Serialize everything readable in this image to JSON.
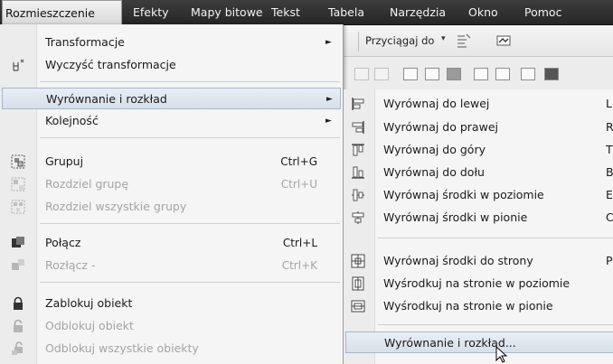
{
  "menubar": {
    "items": [
      {
        "label": "Rozmieszczenie",
        "active": true
      },
      {
        "label": "Efekty"
      },
      {
        "label": "Mapy bitowe"
      },
      {
        "label": "Tekst"
      },
      {
        "label": "Tabela"
      },
      {
        "label": "Narzędzia"
      },
      {
        "label": "Okno"
      },
      {
        "label": "Pomoc"
      }
    ]
  },
  "toolbar": {
    "snap_label": "Przyciągaj do",
    "snap_arrow": "▾"
  },
  "menu": {
    "items": [
      {
        "label": "Transformacje",
        "shortcut": "",
        "submenu": true,
        "disabled": false
      },
      {
        "label": "Wyczyść transformacje",
        "shortcut": "",
        "submenu": false,
        "disabled": false
      },
      {
        "label": "Wyrównanie i rozkład",
        "shortcut": "",
        "submenu": true,
        "disabled": false,
        "highlighted": true
      },
      {
        "label": "Kolejność",
        "shortcut": "",
        "submenu": true,
        "disabled": false
      },
      {
        "label": "Grupuj",
        "shortcut": "Ctrl+G",
        "disabled": false
      },
      {
        "label": "Rozdziel grupę",
        "shortcut": "Ctrl+U",
        "disabled": true
      },
      {
        "label": "Rozdziel wszystkie grupy",
        "shortcut": "",
        "disabled": true
      },
      {
        "label": "Połącz",
        "shortcut": "Ctrl+L",
        "disabled": false
      },
      {
        "label": "Rozłącz -",
        "shortcut": "Ctrl+K",
        "disabled": true
      },
      {
        "label": "Zablokuj obiekt",
        "shortcut": "",
        "disabled": false
      },
      {
        "label": "Odblokuj obiekt",
        "shortcut": "",
        "disabled": true
      },
      {
        "label": "Odblokuj wszystkie obiekty",
        "shortcut": "",
        "disabled": true
      }
    ],
    "submenu_arrow": "►"
  },
  "submenu": {
    "items": [
      {
        "label": "Wyrównaj do lewej",
        "key": "L"
      },
      {
        "label": "Wyrównaj do prawej",
        "key": "R"
      },
      {
        "label": "Wyrównaj do góry",
        "key": "T"
      },
      {
        "label": "Wyrównaj do dołu",
        "key": "B"
      },
      {
        "label": "Wyrównaj środki w poziomie",
        "key": "E"
      },
      {
        "label": "Wyrównaj środki w pionie",
        "key": "C"
      },
      {
        "label": "Wyrównaj środki do strony",
        "key": "P"
      },
      {
        "label": "Wyśrodkuj na stronie w poziomie",
        "key": ""
      },
      {
        "label": "Wyśrodkuj na stronie w pionie",
        "key": ""
      },
      {
        "label": "Wyrównanie i rozkład...",
        "key": "",
        "highlighted": true
      }
    ]
  },
  "colors": {
    "menubar_bg": "#2e2e2e",
    "menu_bg": "#f5f5f5",
    "highlight_bg": "#dde4ec",
    "disabled_text": "#a4a4a4"
  }
}
